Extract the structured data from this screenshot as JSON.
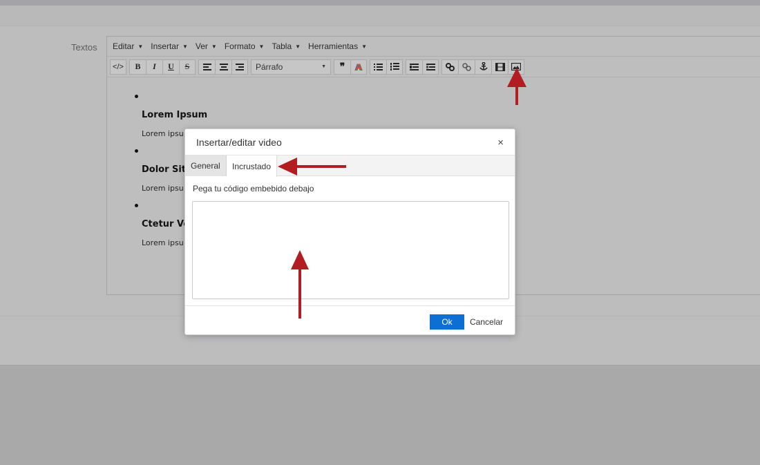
{
  "form": {
    "field_label": "Textos"
  },
  "editor": {
    "menu": [
      {
        "label": "Editar"
      },
      {
        "label": "Insertar"
      },
      {
        "label": "Ver"
      },
      {
        "label": "Formato"
      },
      {
        "label": "Tabla"
      },
      {
        "label": "Herramientas"
      }
    ],
    "toolbar": {
      "code_label": "</>",
      "bold_label": "B",
      "italic_label": "I",
      "underline_label": "U",
      "strike_label": "S",
      "format_select_value": "Párrafo",
      "quote_label": "❞",
      "color_label": "A",
      "icons": [
        "code-icon",
        "bold-icon",
        "italic-icon",
        "underline-icon",
        "strikethrough-icon",
        "align-left-icon",
        "align-center-icon",
        "align-right-icon",
        "blockquote-icon",
        "text-color-icon",
        "bullet-list-icon",
        "numbered-list-icon",
        "outdent-icon",
        "indent-icon",
        "link-icon",
        "unlink-icon",
        "anchor-icon",
        "video-icon",
        "image-icon"
      ]
    },
    "content": [
      {
        "heading": "Lorem Ipsum",
        "text": "Lorem ipsu"
      },
      {
        "heading": "Dolor Sit",
        "text": "Lorem ipsu"
      },
      {
        "heading": "Ctetur Vo",
        "text": "Lorem ipsu"
      }
    ]
  },
  "dialog": {
    "title": "Insertar/editar video",
    "close_label": "×",
    "tabs": [
      {
        "label": "General",
        "active": false
      },
      {
        "label": "Incrustado",
        "active": true
      }
    ],
    "embed_label": "Pega tu código embebido debajo",
    "embed_value": "",
    "ok_label": "Ok",
    "cancel_label": "Cancelar"
  },
  "colors": {
    "overlay_bg": "#a9a9aa",
    "primary_button": "#0d6fd4",
    "annotation_arrow": "#b11d21"
  }
}
